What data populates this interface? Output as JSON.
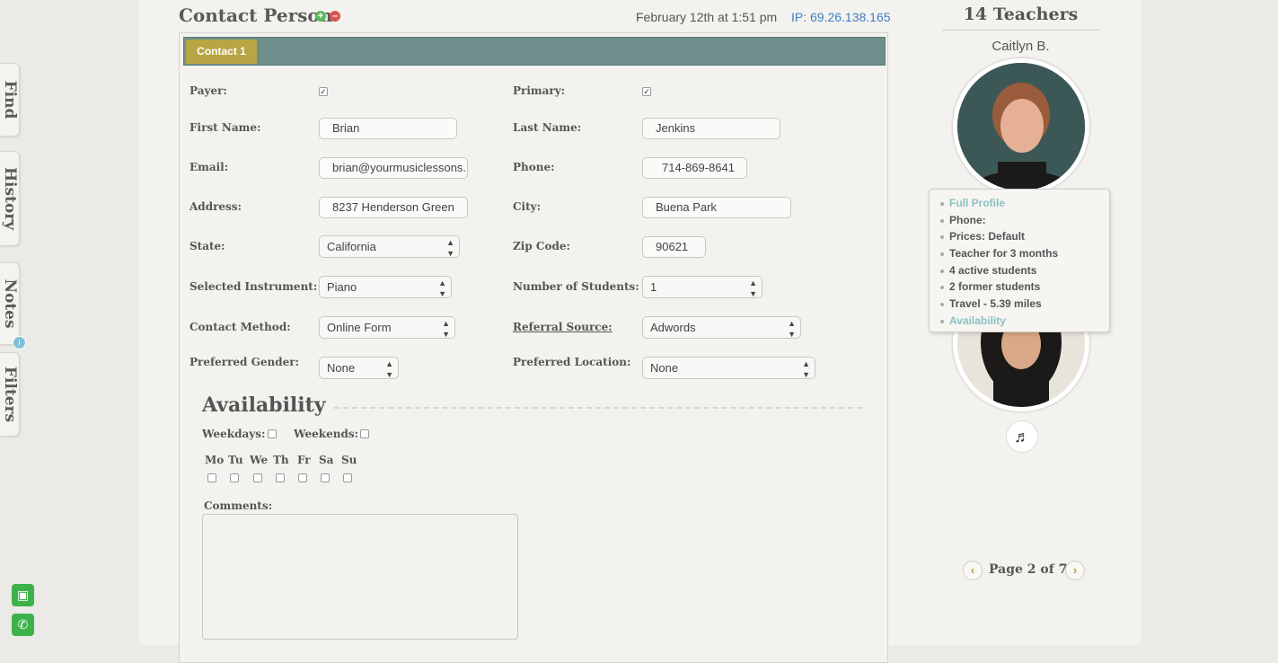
{
  "sidebar_tabs": [
    {
      "label": "Find"
    },
    {
      "label": "History"
    },
    {
      "label": "Notes"
    },
    {
      "label": "Filters"
    }
  ],
  "notes_badge": "i",
  "header": {
    "title": "Contact Person",
    "date": "February 12th at 1:51 pm",
    "ip": "IP: 69.26.138.165",
    "add_icon": "plus-icon",
    "remove_icon": "minus-icon"
  },
  "tabs": [
    {
      "label": "Contact 1"
    }
  ],
  "form": {
    "payer_label": "Payer:",
    "primary_label": "Primary:",
    "first_name_label": "First Name:",
    "first_name": "Brian",
    "last_name_label": "Last Name:",
    "last_name": "Jenkins",
    "email_label": "Email:",
    "email": "brian@yourmusiclessons.",
    "phone_label": "Phone:",
    "phone": "714-869-8641",
    "address_label": "Address:",
    "address": "8237 Henderson Green",
    "city_label": "City:",
    "city": "Buena Park",
    "state_label": "State:",
    "state": "California",
    "zip_label": "Zip Code:",
    "zip": "90621",
    "instrument_label": "Selected Instrument:",
    "instrument": "Piano",
    "num_students_label": "Number of Students:",
    "num_students": "1",
    "contact_method_label": "Contact Method:",
    "contact_method": "Online Form",
    "referral_label": "Referral Source:",
    "referral": "Adwords",
    "gender_label": "Preferred Gender:",
    "gender": "None",
    "location_label": "Preferred Location:",
    "location": "None"
  },
  "availability": {
    "title": "Availability",
    "weekdays_label": "Weekdays:",
    "weekends_label": "Weekends:",
    "days": [
      "Mo",
      "Tu",
      "We",
      "Th",
      "Fr",
      "Sa",
      "Su"
    ],
    "comments_label": "Comments:"
  },
  "teachers": {
    "title": "14 Teachers",
    "name": "Caitlyn B.",
    "popup": {
      "full_profile": "Full Profile",
      "phone": "Phone:",
      "prices": "Prices: Default",
      "tenure": "Teacher for 3 months",
      "active": "4 active students",
      "former": "2 former students",
      "travel": "Travel - 5.39 miles",
      "availability": "Availability"
    },
    "pager": "Page 2 of 7"
  },
  "colors": {
    "tab_bar": "#6e8f8b",
    "tab_active": "#b8a543",
    "ip_link": "#3f7fc4",
    "popup_link": "#8cc1c1",
    "fab_green": "#3eb24a"
  }
}
